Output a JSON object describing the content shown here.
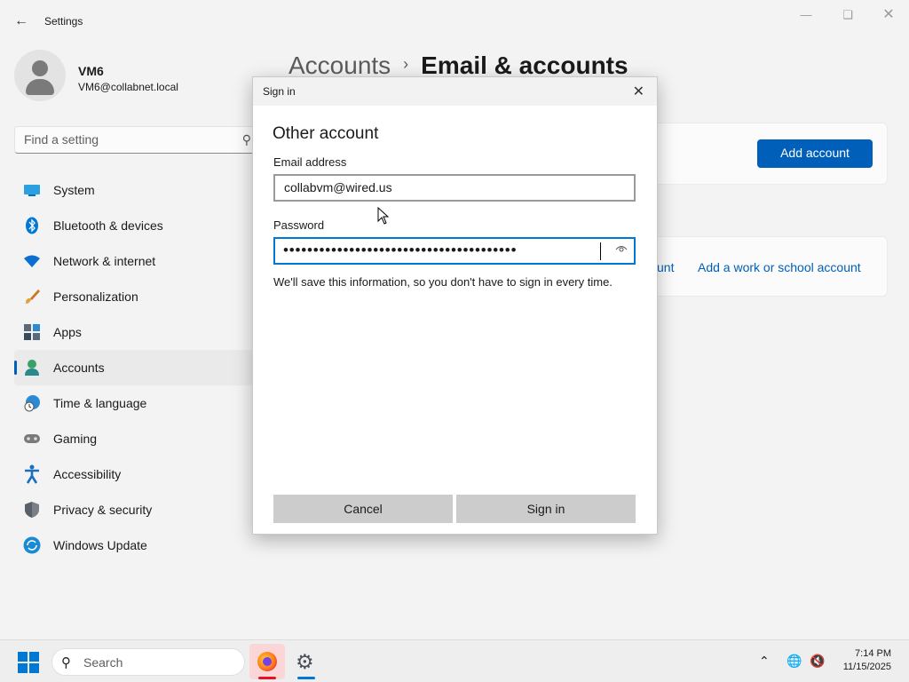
{
  "window": {
    "app_title": "Settings",
    "back_icon": "arrow-left-icon",
    "controls": [
      "minimize",
      "maximize",
      "close"
    ]
  },
  "profile": {
    "name": "VM6",
    "email": "VM6@collabnet.local"
  },
  "search": {
    "placeholder": "Find a setting",
    "icon": "search-icon"
  },
  "nav": {
    "items": [
      {
        "label": "System",
        "icon": "monitor-icon",
        "active": false
      },
      {
        "label": "Bluetooth & devices",
        "icon": "bluetooth-icon",
        "active": false
      },
      {
        "label": "Network & internet",
        "icon": "wifi-icon",
        "active": false
      },
      {
        "label": "Personalization",
        "icon": "brush-icon",
        "active": false
      },
      {
        "label": "Apps",
        "icon": "apps-icon",
        "active": false
      },
      {
        "label": "Accounts",
        "icon": "person-icon",
        "active": true
      },
      {
        "label": "Time & language",
        "icon": "globe-clock-icon",
        "active": false
      },
      {
        "label": "Gaming",
        "icon": "gamepad-icon",
        "active": false
      },
      {
        "label": "Accessibility",
        "icon": "accessibility-icon",
        "active": false
      },
      {
        "label": "Privacy & security",
        "icon": "shield-icon",
        "active": false
      },
      {
        "label": "Windows Update",
        "icon": "update-icon",
        "active": false
      }
    ]
  },
  "breadcrumb": {
    "parent": "Accounts",
    "separator": "›",
    "current": "Email & accounts"
  },
  "main": {
    "add_account_button": "Add account",
    "partial_link": "unt",
    "work_school_link": "Add a work or school account"
  },
  "dialog": {
    "title": "Sign in",
    "heading": "Other account",
    "email_label": "Email address",
    "email_value": "collabvm@wired.us",
    "password_label": "Password",
    "password_mask": "•••••••••••••••••••••••••••••••••••••••",
    "note": "We'll save this information, so you don't have to sign in every time.",
    "cancel_label": "Cancel",
    "signin_label": "Sign in"
  },
  "taskbar": {
    "search_label": "Search",
    "pinned": [
      {
        "name": "Firefox",
        "icon": "firefox-icon",
        "active": true
      },
      {
        "name": "Settings",
        "icon": "settings-gear-icon",
        "active": false
      }
    ],
    "time": "7:14 PM",
    "date": "11/15/2025"
  },
  "colors": {
    "accent": "#005fb8",
    "focus_border": "#0078d4",
    "background": "#f3f3f3",
    "dialog_button": "#cccccc"
  }
}
